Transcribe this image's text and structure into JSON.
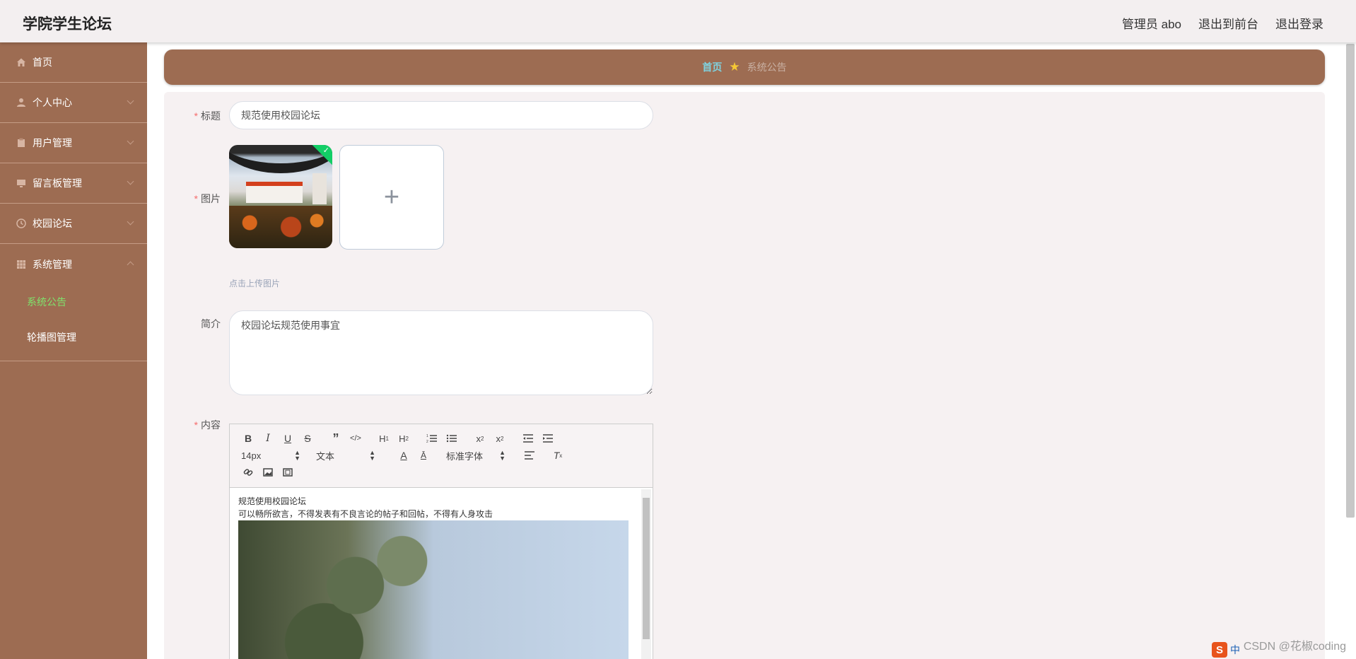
{
  "header": {
    "title": "学院学生论坛",
    "nav": {
      "admin": "管理员 abo",
      "to_front": "退出到前台",
      "logout": "退出登录"
    }
  },
  "sidebar": {
    "items": [
      {
        "label": "首页",
        "icon": "home-icon"
      },
      {
        "label": "个人中心",
        "icon": "user-icon"
      },
      {
        "label": "用户管理",
        "icon": "clipboard-icon"
      },
      {
        "label": "留言板管理",
        "icon": "monitor-icon"
      },
      {
        "label": "校园论坛",
        "icon": "clock-icon"
      },
      {
        "label": "系统管理",
        "icon": "grid-icon"
      }
    ],
    "sub_items": [
      {
        "label": "系统公告",
        "active": true
      },
      {
        "label": "轮播图管理",
        "active": false
      }
    ],
    "active_color": "#7fe36c"
  },
  "breadcrumb": {
    "home": "首页",
    "separator": "★",
    "current": "系统公告"
  },
  "form": {
    "title_label": "标题",
    "title_value": "规范使用校园论坛",
    "image_label": "图片",
    "upload_plus": "+",
    "upload_tip": "点击上传图片",
    "intro_label": "简介",
    "intro_value": "校园论坛规范使用事宜",
    "content_label": "内容",
    "required_mark": "*",
    "upload_success_mark": "✓"
  },
  "editor": {
    "font_size": "14px",
    "header_select": "文本",
    "font_family": "标准字体",
    "content_line1": "规范使用校园论坛",
    "content_line2": "可以畅所欲言，不得发表有不良言论的帖子和回帖，不得有人身攻击"
  },
  "watermark": "CSDN @花椒coding",
  "ime": {
    "logo": "S",
    "lang": "中"
  },
  "colors": {
    "sidebar_bg": "#9d6c52",
    "breadcrumb_home": "#7fd3e0",
    "required": "#f56c6c"
  }
}
